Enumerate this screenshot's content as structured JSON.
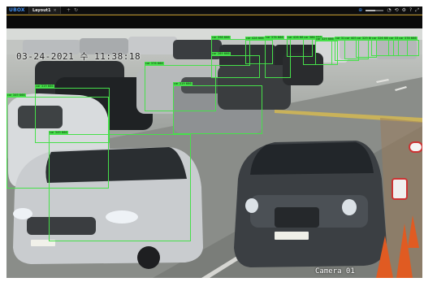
{
  "app": {
    "brand": "UBOX"
  },
  "tabs": [
    {
      "label": "Layout1",
      "close": "×"
    }
  ],
  "toolbar": {
    "add": "+",
    "refresh": "↻",
    "globe": "⊕",
    "icons": [
      "◔",
      "⟲",
      "⚙",
      "?",
      "⤢"
    ],
    "zoom_level": 0.55
  },
  "overlay": {
    "timestamp": "03-24-2021 수 11:38:18",
    "camera_label": "Camera 01"
  },
  "detections": [
    {
      "label": "car 398 666"
    },
    {
      "label": "car 428 666"
    },
    {
      "label": "car 376 666"
    },
    {
      "label": "car 426 666"
    },
    {
      "label": "car 386 666"
    },
    {
      "label": "car 329 666"
    },
    {
      "label": "car 319 666"
    },
    {
      "label": "car 405 666"
    },
    {
      "label": "car 329 667"
    },
    {
      "label": "car 326 666"
    },
    {
      "label": "car 336 666"
    },
    {
      "label": "car 378 666"
    },
    {
      "label": "car 289 666"
    },
    {
      "label": "car 376 666"
    },
    {
      "label": "car 319 666"
    },
    {
      "label": "car 349 666"
    },
    {
      "label": "car 319 666"
    },
    {
      "label": "car 349 666"
    }
  ],
  "colors": {
    "bbox": "#46e04a",
    "accent": "#3f8ef0",
    "divider": "#b58a1e"
  }
}
